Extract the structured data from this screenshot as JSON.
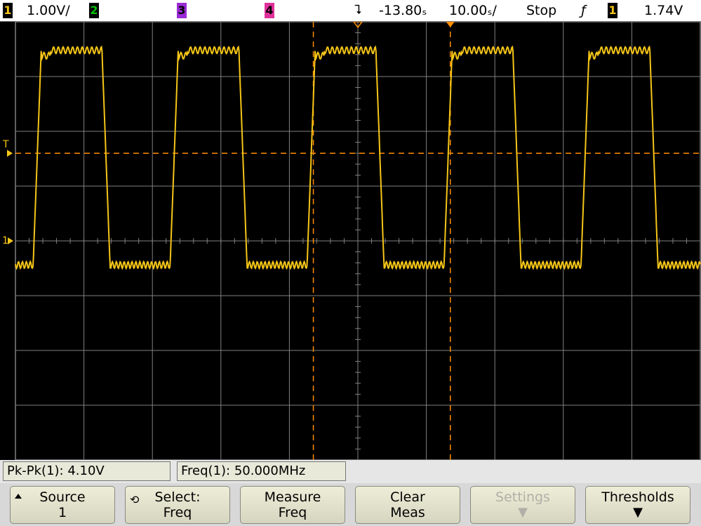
{
  "status_bar": {
    "ch1_badge": "1",
    "ch1_scale": "1.00V/",
    "ch2_badge": "2",
    "ch3_badge": "3",
    "ch4_badge": "4",
    "delay": "-13.80ₛ",
    "timebase": "10.00ₛ/",
    "run_state": "Stop",
    "trigger_slope": "ƒ",
    "trigger_source_badge": "1",
    "trigger_level": "1.74V"
  },
  "colors": {
    "ch1": "#f5c518",
    "ch2": "#00c000",
    "ch3": "#9a2bd6",
    "ch4": "#e0309a",
    "cursor": "#ff8c00",
    "grid": "#808080"
  },
  "markers": {
    "trigger_level_marker": "T",
    "ground_marker": "1"
  },
  "measurements": [
    {
      "label": "Pk-Pk(1): 4.10V"
    },
    {
      "label": "Freq(1): 50.000MHz"
    }
  ],
  "softkeys": [
    {
      "line1": "Source",
      "line2": "1",
      "icon": "arrow-up-icon"
    },
    {
      "line1": "Select:",
      "line2": "Freq",
      "icon": "rotate-knob-icon"
    },
    {
      "line1": "Measure",
      "line2": "Freq"
    },
    {
      "line1": "Clear",
      "line2": "Meas"
    },
    {
      "line1": "Settings",
      "line2": "",
      "icon": "arrow-down-icon",
      "disabled": true
    },
    {
      "line1": "Thresholds",
      "line2": "",
      "icon": "arrow-down-icon"
    }
  ],
  "chart_data": {
    "type": "line",
    "series": [
      {
        "channel": "1",
        "x": [
          0,
          12.5,
          25,
          37.5,
          50
        ],
        "period": 20,
        "high": 3.6,
        "low": -0.4,
        "unit_x": "ns",
        "unit_y": "V"
      }
    ],
    "xlim": [
      0,
      100
    ],
    "ylim": [
      -4,
      4
    ],
    "divisions_x": 10,
    "divisions_y": 8,
    "grid": true,
    "cursors": {
      "x1": 43.5,
      "x2": 63.5,
      "y": 1.6
    }
  }
}
